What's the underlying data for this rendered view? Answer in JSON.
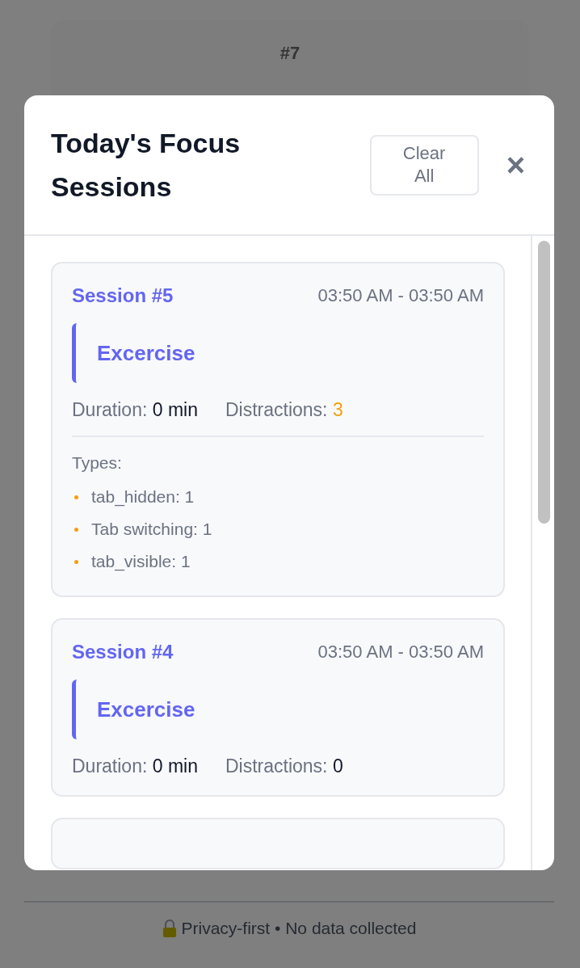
{
  "background": {
    "session_number": "#7",
    "footer": "Privacy-first • No data collected"
  },
  "modal": {
    "title": "Today's Focus Sessions",
    "clear_button": "Clear All",
    "close_button": "×",
    "sessions": [
      {
        "title": "Session #5",
        "time": "03:50 AM - 03:50 AM",
        "category": "Excercise",
        "duration_label": "Duration:",
        "duration": "0 min",
        "distractions_label": "Distractions:",
        "distractions": "3",
        "warning": true,
        "types_label": "Types:",
        "types": [
          "tab_hidden: 1",
          "Tab switching: 1",
          "tab_visible: 1"
        ]
      },
      {
        "title": "Session #4",
        "time": "03:50 AM - 03:50 AM",
        "category": "Excercise",
        "duration_label": "Duration:",
        "duration": "0 min",
        "distractions_label": "Distractions:",
        "distractions": "0",
        "warning": false
      }
    ]
  }
}
